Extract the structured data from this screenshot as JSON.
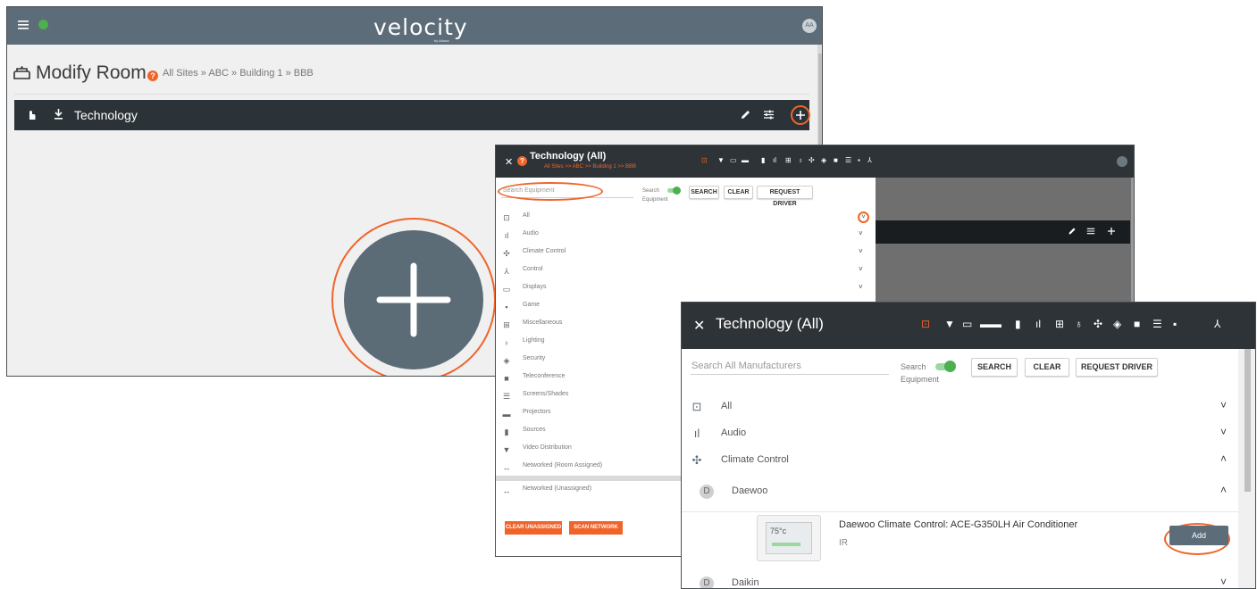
{
  "app": {
    "brand": "velocity",
    "brand_sub": "by Atlona",
    "avatar": "AA"
  },
  "modify_room": {
    "title": "Modify Room",
    "breadcrumb": "All Sites » ABC » Building 1 » BBB",
    "tech_label": "Technology"
  },
  "modal_small": {
    "title": "Technology (All)",
    "breadcrumb": "All Sites >> ABC >> Building 1 >> BBB",
    "search_placeholder": "Search Equipment",
    "toggle_label": "Search Equipment",
    "search_btn": "SEARCH",
    "clear_btn": "CLEAR",
    "request_btn": "REQUEST DRIVER",
    "categories": [
      {
        "label": "All",
        "icon": "all-icon",
        "chevron": true
      },
      {
        "label": "Audio",
        "icon": "audio-icon",
        "chevron": true
      },
      {
        "label": "Climate Control",
        "icon": "fan-icon",
        "chevron": true
      },
      {
        "label": "Control",
        "icon": "control-icon",
        "chevron": true
      },
      {
        "label": "Displays",
        "icon": "display-icon",
        "chevron": true
      },
      {
        "label": "Game",
        "icon": "game-icon",
        "chevron": false
      },
      {
        "label": "Miscellaneous",
        "icon": "misc-icon",
        "chevron": false
      },
      {
        "label": "Lighting",
        "icon": "bulb-icon",
        "chevron": false
      },
      {
        "label": "Security",
        "icon": "shield-icon",
        "chevron": false
      },
      {
        "label": "Teleconference",
        "icon": "camera-icon",
        "chevron": false
      },
      {
        "label": "Screens/Shades",
        "icon": "list-icon",
        "chevron": false
      },
      {
        "label": "Projectors",
        "icon": "projector-icon",
        "chevron": false
      },
      {
        "label": "Sources",
        "icon": "film-icon",
        "chevron": false
      },
      {
        "label": "Video Distribution",
        "icon": "plug-icon",
        "chevron": false
      },
      {
        "label": "Networked (Room Assigned)",
        "icon": "network-icon",
        "chevron": false
      }
    ],
    "unassigned": "Networked (Unassigned)",
    "clear_unassigned": "CLEAR UNASSIGNED",
    "scan_network": "SCAN NETWORK"
  },
  "modal_large": {
    "title": "Technology (All)",
    "search_placeholder": "Search All Manufacturers",
    "toggle_label": "Search Equipment",
    "search_btn": "SEARCH",
    "clear_btn": "CLEAR",
    "request_btn": "REQUEST DRIVER",
    "categories": [
      {
        "label": "All",
        "icon": "all-icon",
        "chevron": "˅"
      },
      {
        "label": "Audio",
        "icon": "audio-icon",
        "chevron": "˅"
      },
      {
        "label": "Climate Control",
        "icon": "fan-icon",
        "chevron": "˄"
      }
    ],
    "brands": [
      {
        "initial": "D",
        "name": "Daewoo",
        "chevron": "˄"
      },
      {
        "initial": "D",
        "name": "Daikin",
        "chevron": "˅"
      }
    ],
    "product": {
      "name": "Daewoo Climate Control: ACE-G350LH Air Conditioner",
      "protocol": "IR",
      "display_temp": "75°c",
      "add_btn": "Add"
    }
  },
  "colors": {
    "accent": "#f0642a",
    "dark_bar": "#2e3337",
    "topbar": "#5c6c78",
    "toggle": "#4caf50",
    "add_button": "#5c6c78"
  }
}
